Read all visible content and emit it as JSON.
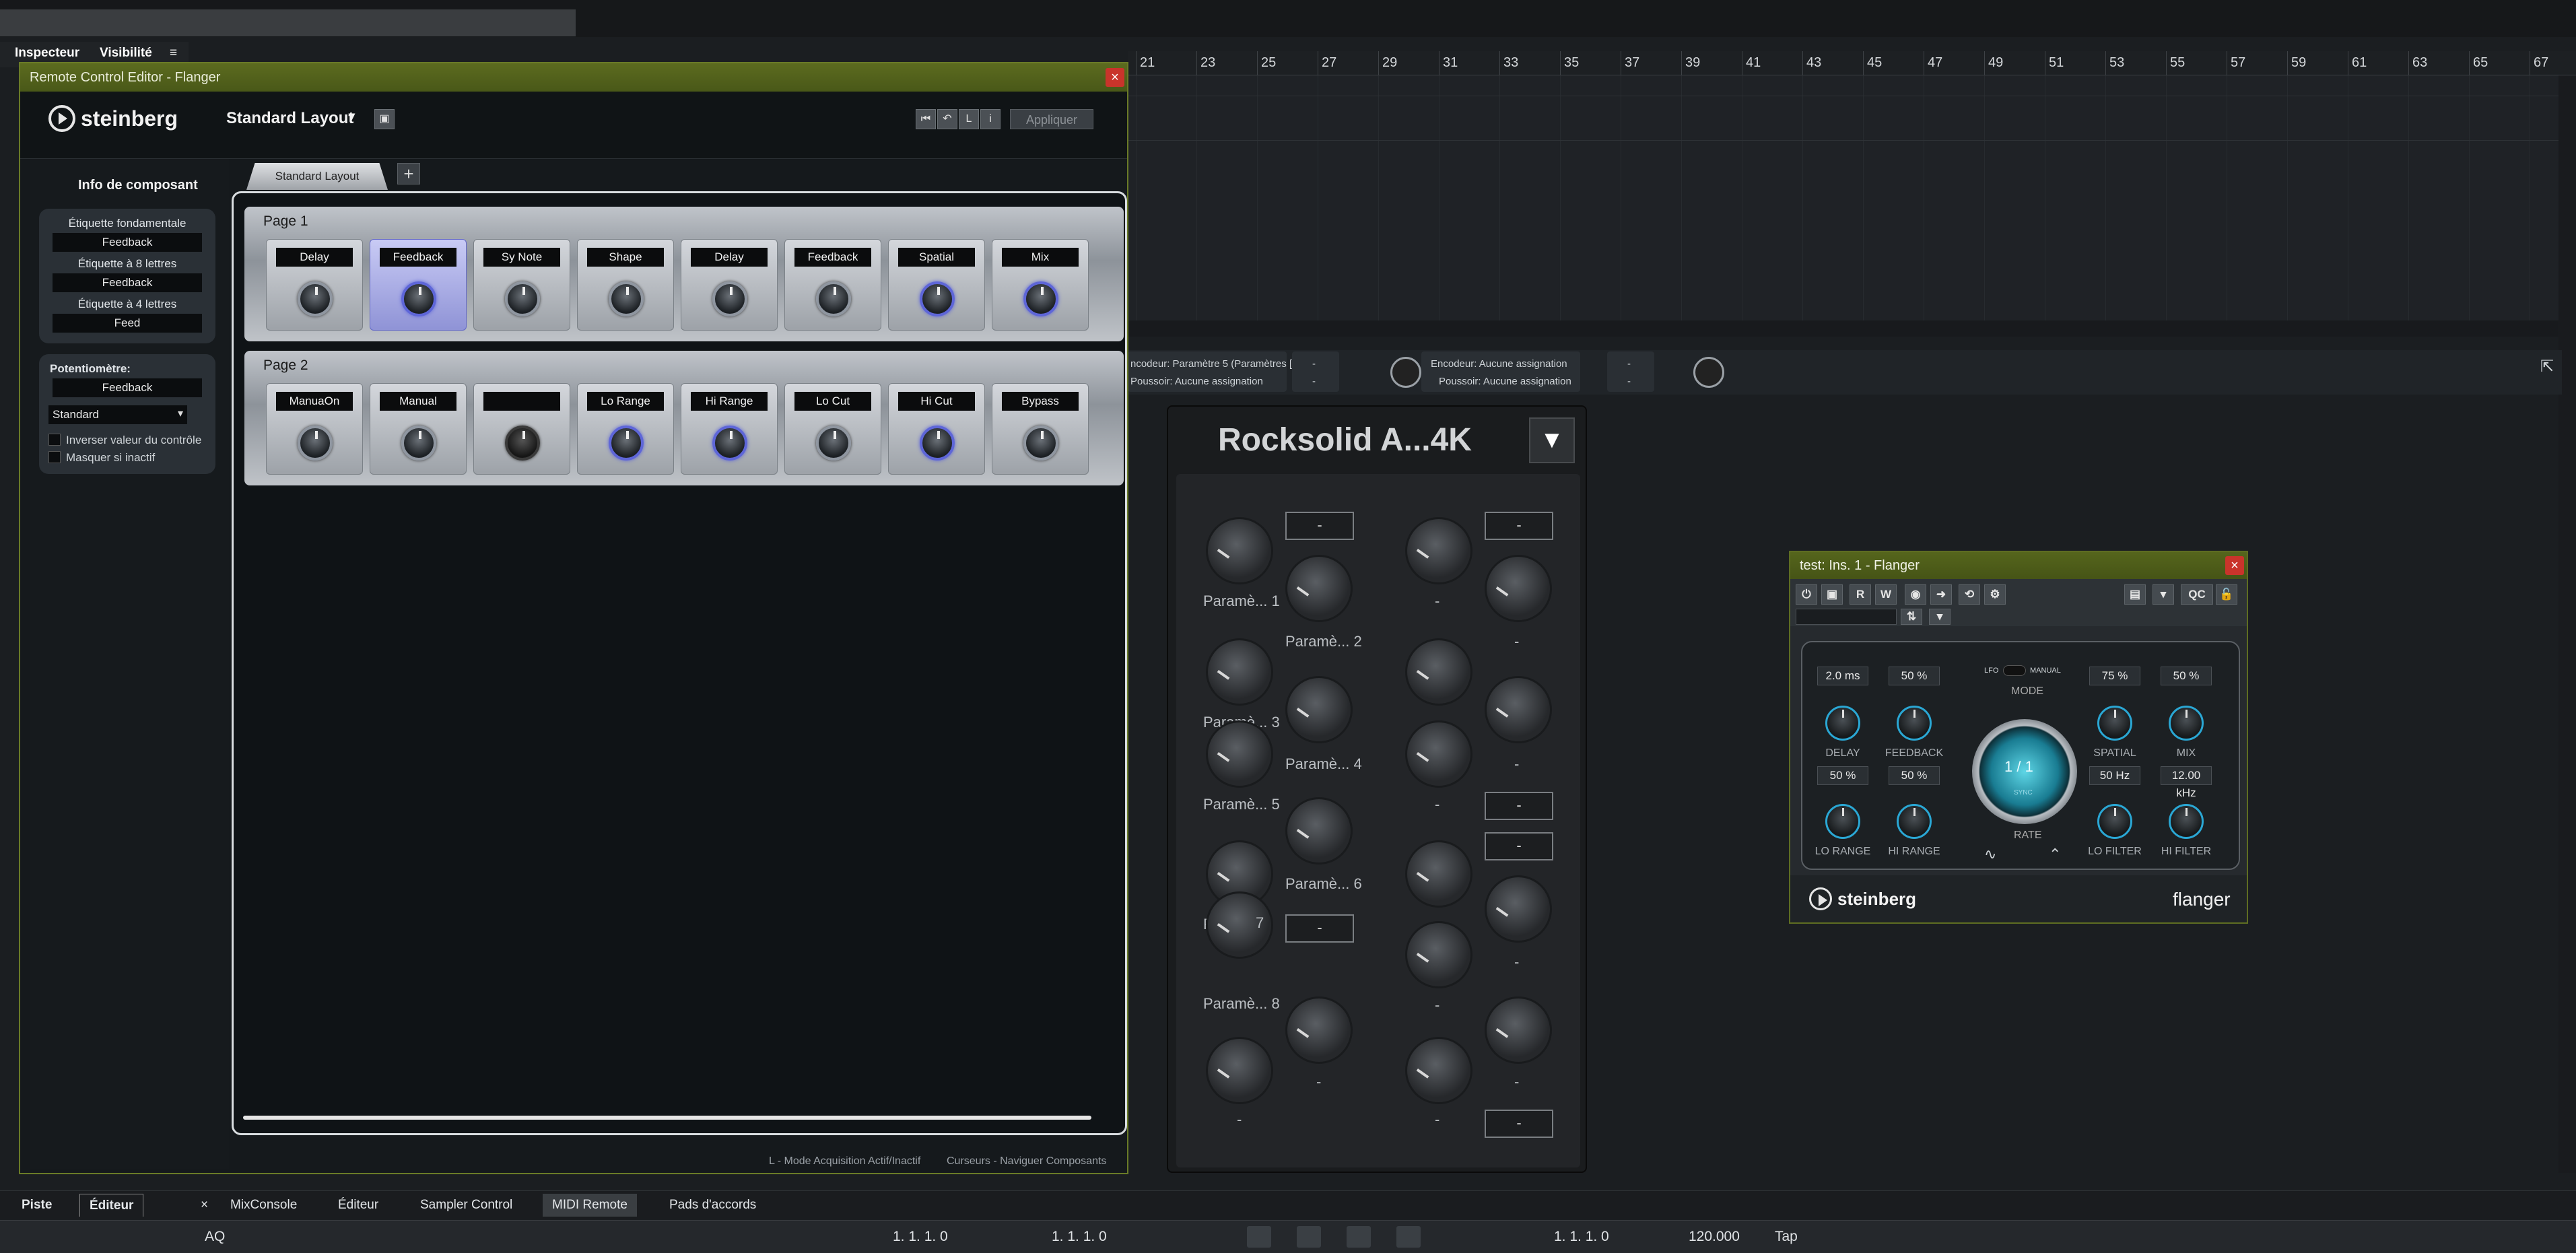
{
  "top": {
    "tabs": [
      "Inspecteur",
      "Visibilité"
    ]
  },
  "ruler": {
    "numbers": [
      "21",
      "23",
      "25",
      "27",
      "29",
      "31",
      "33",
      "35",
      "37",
      "39",
      "41",
      "43",
      "45",
      "47",
      "49",
      "51",
      "53",
      "55",
      "57",
      "59",
      "61",
      "63",
      "65",
      "67"
    ]
  },
  "rce": {
    "title": "Remote Control Editor - Flanger",
    "brand": "steinberg",
    "layout_name": "Standard Layout",
    "apply_label": "Appliquer",
    "info_heading": "Info de composant",
    "label_fund": "Étiquette fondamentale",
    "value_fund": "Feedback",
    "label_8": "Étiquette à 8 lettres",
    "value_8": "Feedback",
    "label_4": "Étiquette à 4 lettres",
    "value_4": "Feed",
    "pot_heading": "Potentiomètre:",
    "pot_value": "Feedback",
    "pot_mode": "Standard",
    "invert_label": "Inverser valeur du contrôle",
    "hide_label": "Masquer si inactif",
    "tab_label": "Standard Layout",
    "page1": {
      "label": "Page 1",
      "slots": [
        "Delay",
        "Feedback",
        "Sy Note",
        "Shape",
        "Delay",
        "Feedback",
        "Spatial",
        "Mix"
      ]
    },
    "page2": {
      "label": "Page 2",
      "slots": [
        "ManuaOn",
        "Manual",
        "",
        "Lo Range",
        "Hi Range",
        "Lo Cut",
        "Hi Cut",
        "Bypass"
      ]
    },
    "status_left": "L - Mode Acquisition Actif/Inactif",
    "status_right": "Curseurs - Naviguer Composants"
  },
  "assign": {
    "a1_enc": "ncodeur: Paramètre 5 (Paramètres [..",
    "a1_push": "Poussoir: Aucune assignation",
    "dash": "-",
    "a2_enc": "Encodeur: Aucune assignation",
    "a2_push": "Poussoir: Aucune assignation"
  },
  "rocksolid": {
    "title": "Rocksolid A...4K",
    "labels": [
      "Paramè... 1",
      "Paramè... 2",
      "Paramè... 3",
      "Paramè... 4",
      "Paramè... 5",
      "Paramè... 6",
      "P",
      "7",
      "Paramè... 8"
    ],
    "dash": "-"
  },
  "flanger": {
    "title": "test: Ins. 1 - Flanger",
    "tool": [
      "R",
      "W",
      "QC"
    ],
    "delay_val": "2.0 ms",
    "feedback_val": "50 %",
    "spatial_val": "75 %",
    "mix_val": "50 %",
    "lfo": "LFO",
    "manual": "MANUAL",
    "mode": "MODE",
    "delay": "DELAY",
    "feedback": "FEEDBACK",
    "spatial": "SPATIAL",
    "mix": "MIX",
    "lorange_val": "50 %",
    "hirange_val": "50 %",
    "lofilter_val": "50 Hz",
    "hifilter_val": "12.00 kHz",
    "rate_display": "1 / 1",
    "sync": "SYNC",
    "rate": "RATE",
    "lorange": "LO RANGE",
    "hirange": "HI RANGE",
    "lofilter": "LO FILTER",
    "hifilter": "HI FILTER",
    "brand": "steinberg",
    "product": "flanger"
  },
  "bottom_tabs": [
    "Piste",
    "Éditeur",
    "MixConsole",
    "Éditeur",
    "Sampler Control",
    "MIDI Remote",
    "Pads d'accords"
  ],
  "transport": {
    "pos1": "1. 1. 1.   0",
    "pos2": "1. 1. 1.   0",
    "pos3": "1. 1. 1.   0",
    "tempo": "120.000",
    "tap": "Tap",
    "aq": "AQ"
  },
  "colors": {
    "accent_green": "#5c6b1f",
    "knob_blue": "#5e66d8",
    "flanger_cyan": "#2aa7d4"
  }
}
